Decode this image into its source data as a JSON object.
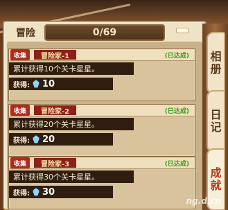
{
  "header": {
    "title": "冒险",
    "progress_text": "0/69",
    "progress_fraction": 0
  },
  "cards": [
    {
      "tag": "收集",
      "name": "冒险家-1",
      "status": "(已达成)",
      "description": "累计获得10个关卡星星。",
      "reward_label": "获得:",
      "reward_amount": "10"
    },
    {
      "tag": "收集",
      "name": "冒险家-2",
      "status": "(已达成)",
      "description": "累计获得20个关卡星星。",
      "reward_label": "获得:",
      "reward_amount": "20"
    },
    {
      "tag": "收集",
      "name": "冒险家-3",
      "status": "(已达成)",
      "description": "累计获得30个关卡星星。",
      "reward_label": "获得:",
      "reward_amount": "30"
    }
  ],
  "tabs": [
    {
      "label_top": "相",
      "label_bottom": "册"
    },
    {
      "label_top": "日",
      "label_bottom": "记"
    },
    {
      "label_top": "成",
      "label_bottom": "就"
    }
  ],
  "watermark": "ng.d.cn",
  "colors": {
    "tag_red": "#b12a1d",
    "status_green": "#3a9a1a",
    "gem_blue": "#8fd4ff"
  }
}
